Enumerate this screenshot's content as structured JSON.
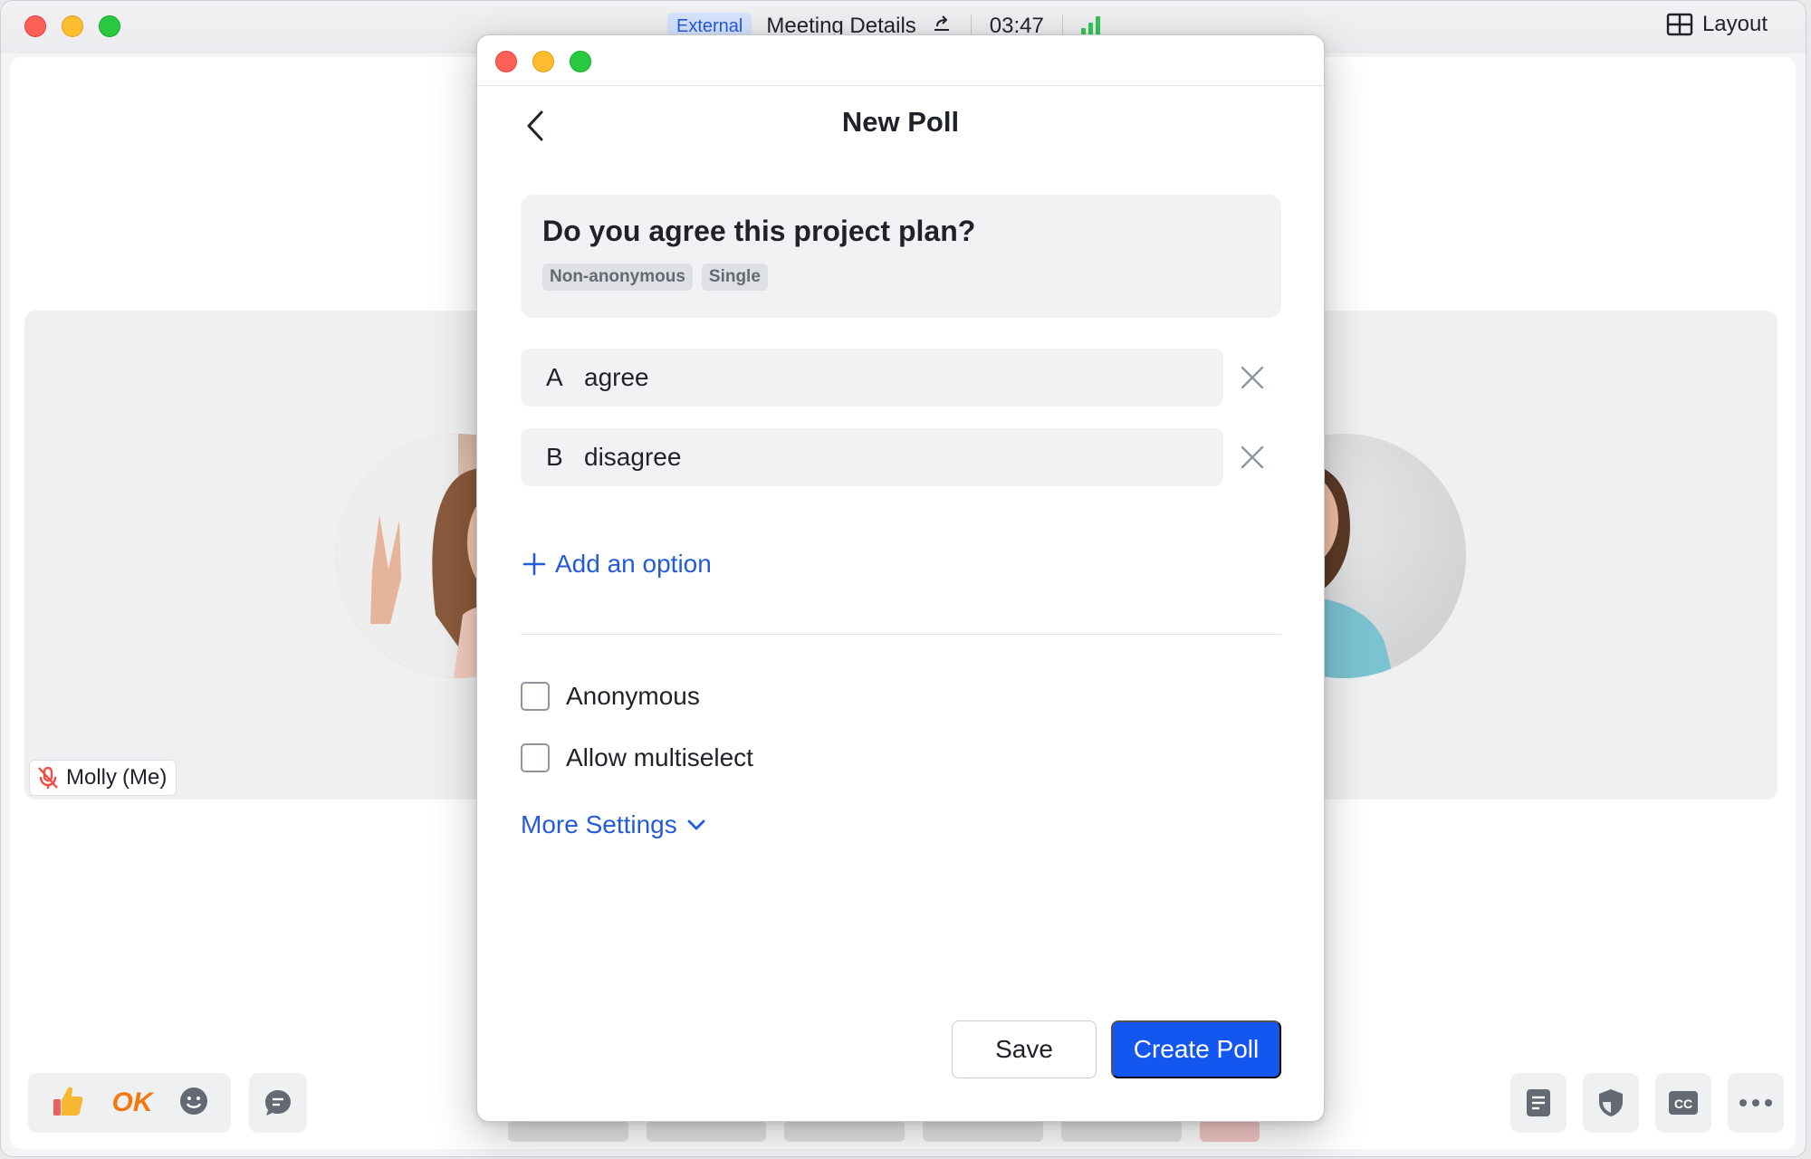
{
  "main_window": {
    "badge": "External",
    "title": "Meeting Details",
    "timer": "03:47",
    "layout_label": "Layout",
    "participant_name": "Molly",
    "participant_suffix": "(Me)",
    "reaction_ok": "OK"
  },
  "poll": {
    "title": "New Poll",
    "question": "Do you agree this project plan?",
    "tags": [
      "Non-anonymous",
      "Single"
    ],
    "options": [
      {
        "letter": "A",
        "text": "agree"
      },
      {
        "letter": "B",
        "text": "disagree"
      }
    ],
    "add_option_label": "Add an option",
    "anonymous_label": "Anonymous",
    "anonymous_checked": false,
    "multiselect_label": "Allow multiselect",
    "multiselect_checked": false,
    "more_settings_label": "More Settings",
    "save_label": "Save",
    "create_label": "Create Poll"
  },
  "colors": {
    "accent": "#1456f0",
    "link": "#245bdb",
    "signal": "#34c759",
    "ok_reaction": "#f5770f"
  }
}
